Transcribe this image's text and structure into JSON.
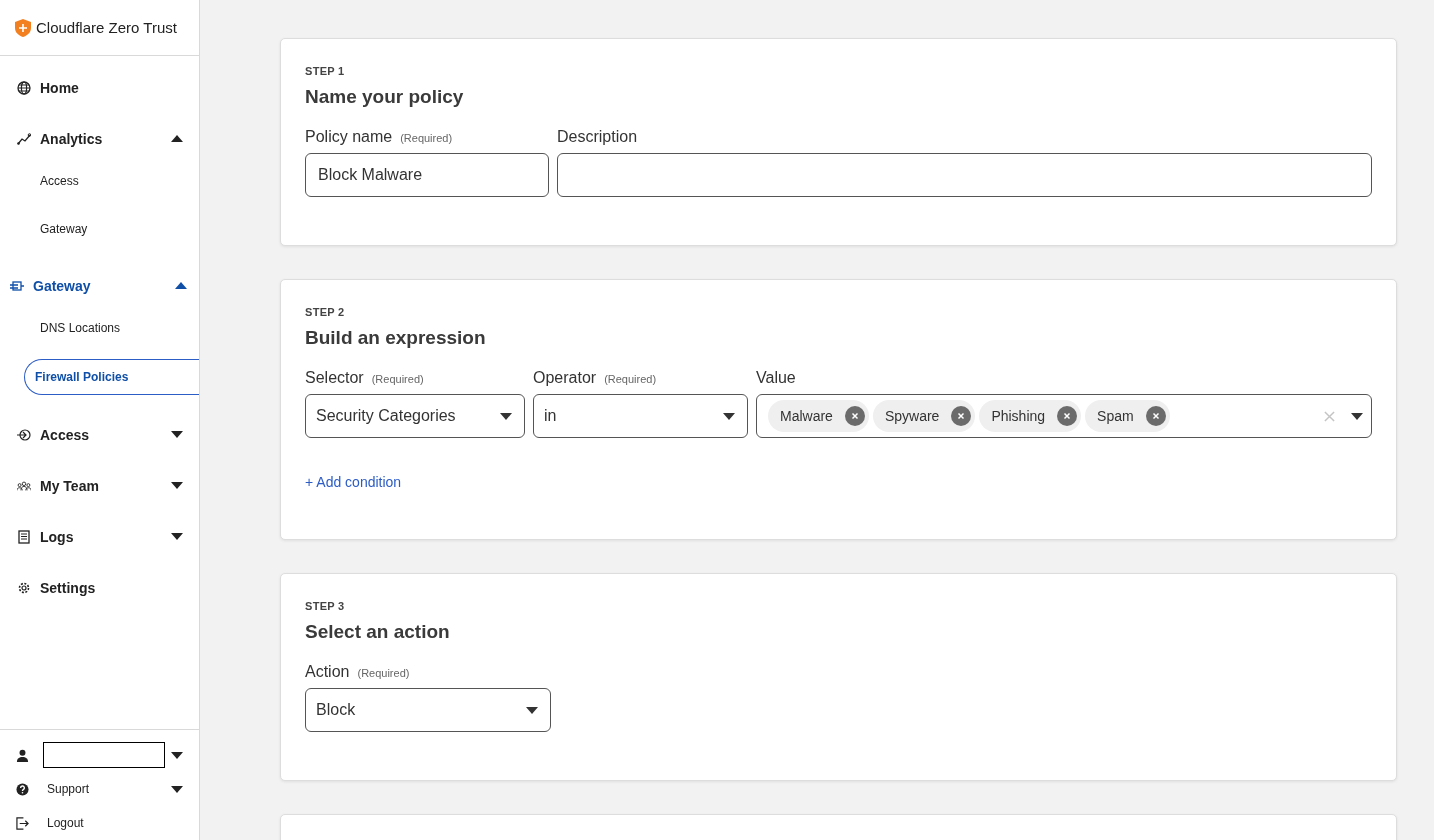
{
  "brand": {
    "name": "Cloudflare Zero Trust"
  },
  "sidebar": {
    "items": [
      {
        "label": "Home",
        "selected": false
      },
      {
        "label": "Analytics",
        "expanded": true,
        "selected": false,
        "children": [
          {
            "label": "Access",
            "selected": false
          },
          {
            "label": "Gateway",
            "selected": false
          }
        ]
      },
      {
        "label": "Gateway",
        "expanded": true,
        "selected": true,
        "children": [
          {
            "label": "DNS Locations",
            "selected": false
          },
          {
            "label": "Firewall Policies",
            "selected": true
          }
        ]
      },
      {
        "label": "Access",
        "expanded": false,
        "selected": false
      },
      {
        "label": "My Team",
        "expanded": false,
        "selected": false
      },
      {
        "label": "Logs",
        "expanded": false,
        "selected": false
      },
      {
        "label": "Settings",
        "selected": false
      }
    ],
    "footer": [
      {
        "kind": "account"
      },
      {
        "kind": "support",
        "label": "Support"
      },
      {
        "kind": "logout",
        "label": "Logout"
      }
    ]
  },
  "steps": [
    {
      "step": "STEP 1",
      "title": "Name your policy",
      "fields": [
        {
          "kind": "text",
          "label": "Policy name",
          "required": "(Required)",
          "value": "Block Malware"
        },
        {
          "kind": "text",
          "label": "Description"
        }
      ]
    },
    {
      "step": "STEP 2",
      "title": "Build an expression",
      "fields": [
        {
          "kind": "select",
          "label": "Selector",
          "required": "(Required)",
          "value": "Security Categories"
        },
        {
          "kind": "select",
          "label": "Operator",
          "required": "(Required)",
          "value": "in"
        },
        {
          "kind": "multi",
          "label": "Value",
          "tags": [
            "Malware",
            "Spyware",
            "Phishing",
            "Spam"
          ]
        }
      ],
      "link": "+ Add condition"
    },
    {
      "step": "STEP 3",
      "title": "Select an action",
      "fields": [
        {
          "kind": "select",
          "label": "Action",
          "required": "(Required)",
          "value": "Block"
        }
      ]
    }
  ]
}
